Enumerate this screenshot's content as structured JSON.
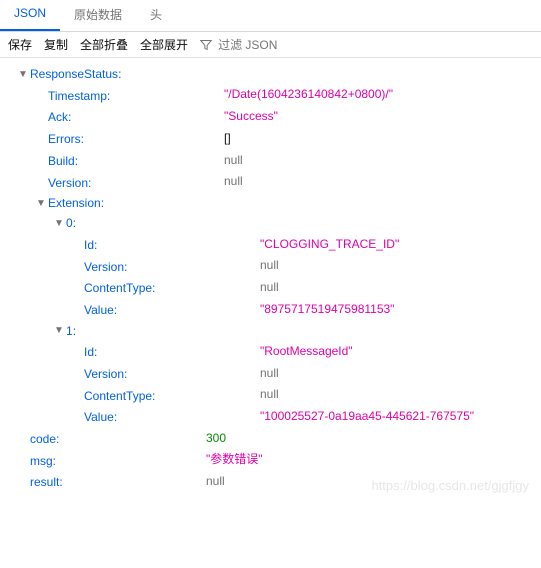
{
  "tabs": {
    "json": "JSON",
    "raw": "原始数据",
    "headers": "头"
  },
  "toolbar": {
    "save": "保存",
    "copy": "复制",
    "collapseAll": "全部折叠",
    "expandAll": "全部展开",
    "filterPlaceholder": "过滤 JSON"
  },
  "tree": {
    "responseStatus": {
      "key": "ResponseStatus",
      "timestamp": {
        "key": "Timestamp",
        "val": "\"/Date(1604236140842+0800)/\""
      },
      "ack": {
        "key": "Ack",
        "val": "\"Success\""
      },
      "errors": {
        "key": "Errors",
        "val": "[]"
      },
      "build": {
        "key": "Build",
        "val": "null"
      },
      "version": {
        "key": "Version",
        "val": "null"
      },
      "extension": {
        "key": "Extension",
        "items": [
          {
            "index": "0",
            "id": {
              "key": "Id",
              "val": "\"CLOGGING_TRACE_ID\""
            },
            "version": {
              "key": "Version",
              "val": "null"
            },
            "contentType": {
              "key": "ContentType",
              "val": "null"
            },
            "value": {
              "key": "Value",
              "val": "\"8975717519475981153\""
            }
          },
          {
            "index": "1",
            "id": {
              "key": "Id",
              "val": "\"RootMessageId\""
            },
            "version": {
              "key": "Version",
              "val": "null"
            },
            "contentType": {
              "key": "ContentType",
              "val": "null"
            },
            "value": {
              "key": "Value",
              "val": "\"100025527-0a19aa45-445621-767575\""
            }
          }
        ]
      }
    },
    "code": {
      "key": "code",
      "val": "300"
    },
    "msg": {
      "key": "msg",
      "val": "\"参数错误\""
    },
    "result": {
      "key": "result",
      "val": "null"
    }
  },
  "watermark": "https://blog.csdn.net/gjgfjgy"
}
